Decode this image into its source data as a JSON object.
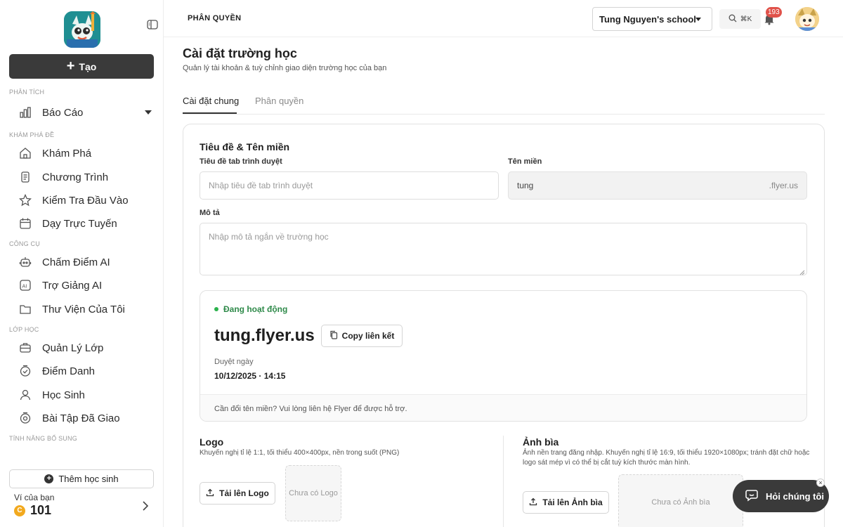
{
  "sidebar": {
    "create_label": "Tạo",
    "sections": {
      "analytics": "PHÂN TÍCH",
      "explore": "KHÁM PHÁ ĐỀ",
      "tools": "CÔNG CỤ",
      "classes": "LỚP HỌC",
      "extra": "TÍNH NĂNG BỔ SUNG"
    },
    "items": {
      "reports": "Báo Cáo",
      "explore": "Khám Phá",
      "programs": "Chương Trình",
      "entrance_test": "Kiểm Tra Đầu Vào",
      "online_teaching": "Dạy Trực Tuyến",
      "ai_grading": "Chấm Điểm AI",
      "ai_assistant": "Trợ Giảng AI",
      "my_library": "Thư Viện Của Tôi",
      "class_management": "Quản Lý Lớp",
      "attendance": "Điểm Danh",
      "students": "Học Sinh",
      "assigned_homework": "Bài Tập Đã Giao"
    },
    "add_student_label": "Thêm học sinh",
    "wallet_label": "Ví của bạn",
    "wallet_coin": "C",
    "wallet_value": "101"
  },
  "topbar": {
    "title": "PHÂN QUYỀN",
    "school_name": "Tung Nguyen's school",
    "search_shortcut": "⌘K",
    "notification_count": "193"
  },
  "main": {
    "title": "Cài đặt trường học",
    "subtitle": "Quản lý tài khoản & tuỳ chỉnh giao diện trường học của bạn",
    "tabs": [
      "Cài đặt chung",
      "Phân quyền"
    ],
    "section_title": "Tiêu đề & Tên miền",
    "browser_tab_label": "Tiêu đề tab trình duyệt",
    "browser_tab_placeholder": "Nhập tiêu đề tab trình duyệt",
    "domain_label": "Tên miền",
    "domain_value": "tung",
    "domain_suffix": ".flyer.us",
    "description_label": "Mô tả",
    "description_placeholder": "Nhập mô tả ngắn về trường học",
    "domain_card": {
      "status": "Đang hoạt động",
      "url": "tung.flyer.us",
      "copy_label": "Copy liên kết",
      "approved_label": "Duyệt ngày",
      "approved_value": "10/12/2025 · 14:15",
      "footer": "Cần đổi tên miền? Vui lòng liên hệ Flyer để được hỗ trợ."
    },
    "logo": {
      "title": "Logo",
      "desc": "Khuyến nghị tỉ lệ 1:1, tối thiểu 400×400px, nền trong suốt (PNG)",
      "upload_label": "Tải lên Logo",
      "placeholder": "Chưa có Logo"
    },
    "cover": {
      "title": "Ảnh bìa",
      "desc": "Ảnh nền trang đăng nhập. Khuyến nghị tỉ lệ 16:9, tối thiểu 1920×1080px; tránh đặt chữ hoặc logo sát mép vì có thể bị cắt tuỳ kích thước màn hình.",
      "upload_label": "Tải lên Ảnh bìa",
      "placeholder": "Chưa có Ảnh bìa"
    }
  },
  "help": {
    "label": "Hỏi chúng tôi",
    "close": "×"
  },
  "colors": {
    "primary_dark": "#3a3a3a",
    "active_green": "#2f8a4a",
    "badge_red": "#e0524a",
    "coin_gold": "#f2a91e",
    "logo_teal": "#1f8f92"
  }
}
